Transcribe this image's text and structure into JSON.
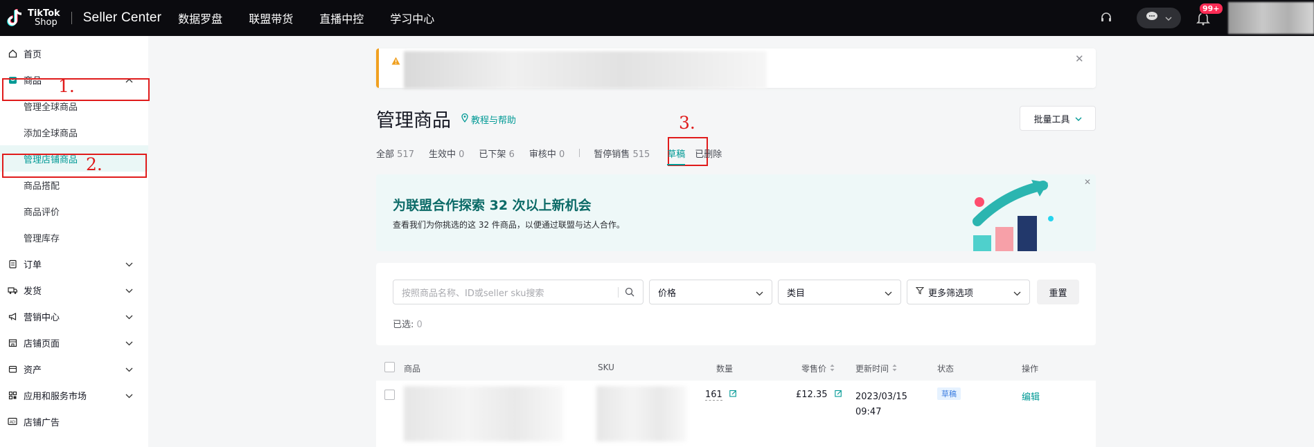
{
  "topbar": {
    "logo_line1": "TikTok",
    "logo_line2": "Shop",
    "brand": "Seller Center",
    "nav": [
      "数据罗盘",
      "联盟带货",
      "直播中控",
      "学习中心"
    ],
    "notification_count": "99+"
  },
  "sidebar": {
    "items": [
      {
        "label": "首页",
        "icon": "home-icon"
      },
      {
        "label": "商品",
        "icon": "product-icon",
        "expanded": true
      },
      {
        "label": "订单",
        "icon": "order-icon"
      },
      {
        "label": "发货",
        "icon": "truck-icon"
      },
      {
        "label": "营销中心",
        "icon": "megaphone-icon"
      },
      {
        "label": "店铺页面",
        "icon": "store-icon"
      },
      {
        "label": "资产",
        "icon": "wallet-icon"
      },
      {
        "label": "应用和服务市场",
        "icon": "apps-icon"
      },
      {
        "label": "店铺广告",
        "icon": "ad-icon"
      }
    ],
    "sub_items": [
      "管理全球商品",
      "添加全球商品",
      "管理店铺商品",
      "商品搭配",
      "商品评价",
      "管理库存"
    ],
    "active_sub": "管理店铺商品"
  },
  "annotations": {
    "step1": "1.",
    "step2": "2.",
    "step3": "3.",
    "color": "#e01b1b"
  },
  "main": {
    "title": "管理商品",
    "help_link": "教程与帮助",
    "batch_tools": "批量工具",
    "tabs": [
      {
        "label": "全部",
        "count": "517"
      },
      {
        "label": "生效中",
        "count": "0"
      },
      {
        "label": "已下架",
        "count": "6"
      },
      {
        "label": "审核中",
        "count": "0"
      },
      {
        "label": "暂停销售",
        "count": "515"
      },
      {
        "label": "草稿",
        "count": ""
      },
      {
        "label": "已删除",
        "count": ""
      }
    ],
    "active_tab": "草稿",
    "banner": {
      "title": "为联盟合作探索 32 次以上新机会",
      "subtitle": "查看我们为你挑选的这 32 件商品，以便通过联盟与达人合作。"
    },
    "filters": {
      "search_placeholder": "按照商品名称、ID或seller sku搜索",
      "price": "价格",
      "category": "类目",
      "more_filters": "更多筛选项",
      "reset": "重置",
      "selected_label": "已选:",
      "selected_count": "0"
    },
    "table": {
      "columns": [
        "商品",
        "SKU",
        "数量",
        "零售价",
        "更新时间",
        "状态",
        "操作"
      ],
      "rows": [
        {
          "quantity": "161",
          "price": "£12.35",
          "updated_date": "2023/03/15",
          "updated_time": "09:47",
          "status": "草稿",
          "action": "编辑"
        }
      ]
    }
  },
  "colors": {
    "accent": "#009995",
    "topbar": "#0b0b0f",
    "badge": "#fe2c55",
    "warning": "#f0a020"
  }
}
